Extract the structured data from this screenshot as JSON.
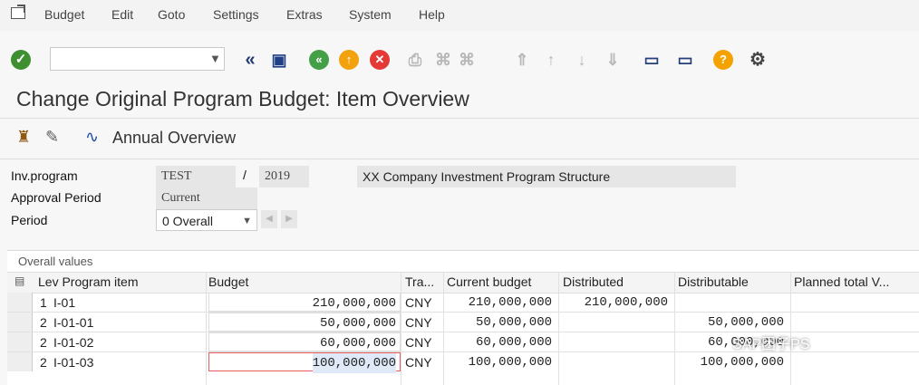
{
  "menu": {
    "items": [
      "Budget",
      "Edit",
      "Goto",
      "Settings",
      "Extras",
      "System",
      "Help"
    ]
  },
  "page": {
    "title": "Change Original Program Budget: Item Overview"
  },
  "toolbar": {
    "annual_overview": "Annual Overview"
  },
  "header": {
    "inv_program_label": "Inv.program",
    "inv_program": "TEST",
    "slash": "/",
    "year": "2019",
    "description": "XX Company Investment Program Structure",
    "approval_label": "Approval Period",
    "approval_value": "Current",
    "period_label": "Period",
    "period_value": "0 Overall"
  },
  "table": {
    "title": "Overall values",
    "columns": [
      "Lev Program item",
      "Budget",
      "Tra...",
      "Current budget",
      "Distributed",
      "Distributable",
      "Planned total V..."
    ],
    "rows": [
      {
        "lev": "1",
        "item": "I-01",
        "budget": "210,000,000",
        "cur": "CNY",
        "current": "210,000,000",
        "distributed": "210,000,000",
        "distributable": ""
      },
      {
        "lev": "2",
        "item": "I-01-01",
        "budget": "50,000,000",
        "cur": "CNY",
        "current": "50,000,000",
        "distributed": "",
        "distributable": "50,000,000"
      },
      {
        "lev": "2",
        "item": "I-01-02",
        "budget": "60,000,000",
        "cur": "CNY",
        "current": "60,000,000",
        "distributed": "",
        "distributable": "60,000,000"
      },
      {
        "lev": "2",
        "item": "I-01-03",
        "budget": "100,000,000",
        "cur": "CNY",
        "current": "100,000,000",
        "distributed": "",
        "distributable": "100,000,000"
      }
    ]
  },
  "watermark": "SAP团子PS",
  "colors": {
    "ok": "#3d8f2f",
    "back": "#43a047",
    "exit": "#f2a20c",
    "cancel": "#e53935",
    "help": "#f3a200"
  }
}
